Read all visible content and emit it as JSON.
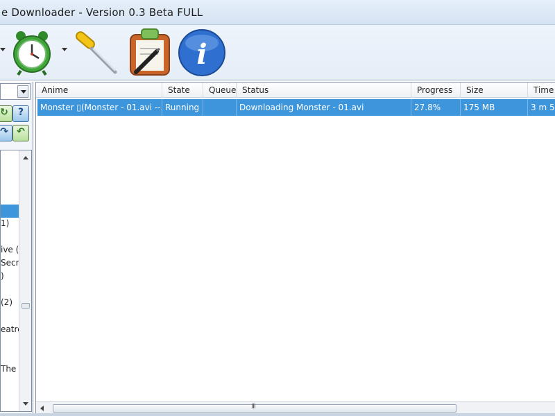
{
  "window": {
    "title": "e Downloader - Version 0.3 Beta FULL"
  },
  "toolbar": {
    "icons": [
      "alarm-clock-icon",
      "screwdriver-settings-icon",
      "clipboard-pen-icon",
      "info-icon"
    ],
    "info_glyph": "i"
  },
  "left_panel": {
    "buttons": [
      {
        "icon": "refresh-icon",
        "glyph": "↻"
      },
      {
        "icon": "help-icon",
        "glyph": "?"
      },
      {
        "icon": "redo-icon",
        "glyph": "↷"
      },
      {
        "icon": "back-icon",
        "glyph": "↶"
      }
    ],
    "tree_items": [
      "1)",
      "ive (",
      "Secre",
      ")",
      "(2)",
      "eatre",
      "The"
    ]
  },
  "downloads": {
    "columns": [
      "Anime",
      "State",
      "Queue",
      "Status",
      "Progress",
      "Size",
      "Time l"
    ],
    "rows": [
      {
        "anime": "Monster ▯(Monster - 01.avi --...",
        "state": "Running",
        "queue": "",
        "status": "Downloading Monster - 01.avi",
        "progress": "27.8%",
        "size": "175 MB",
        "time_left": "3 m 5"
      }
    ]
  },
  "scrollbar": {
    "grip": "III"
  },
  "colors": {
    "selection": "#3d95dc",
    "titlebar": "#dde8f5"
  }
}
